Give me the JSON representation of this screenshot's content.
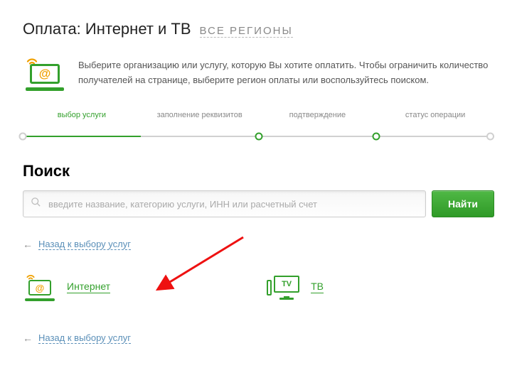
{
  "header": {
    "title": "Оплата: Интернет и ТВ",
    "region_link": "ВСЕ РЕГИОНЫ",
    "intro": "Выберите организацию или услугу, которую Вы хотите оплатить. Чтобы ограничить количество получателей на странице, выберите регион оплаты или воспользуйтесь поиском."
  },
  "stepper": {
    "steps": [
      "выбор услуги",
      "заполнение реквизитов",
      "подтверждение",
      "статус операции"
    ],
    "active_index": 0
  },
  "search": {
    "heading": "Поиск",
    "placeholder": "введите название, категорию услуги, ИНН или расчетный счет",
    "button": "Найти"
  },
  "back_link": "Назад к выбору услуг",
  "categories": [
    {
      "key": "internet",
      "label": "Интернет",
      "icon": "internet-laptop-icon"
    },
    {
      "key": "tv",
      "label": "ТВ",
      "icon": "tv-icon"
    }
  ],
  "colors": {
    "accent": "#33a02c",
    "link": "#5a8fb8",
    "wifi": "#f0a000"
  }
}
